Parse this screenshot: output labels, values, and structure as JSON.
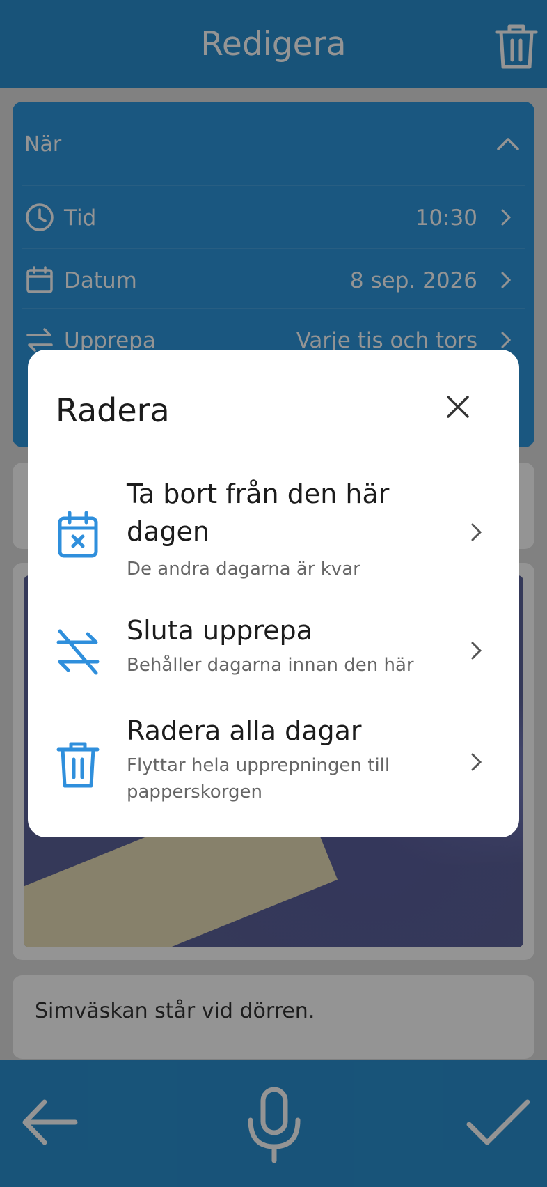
{
  "header": {
    "title": "Redigera",
    "trash_icon": "trash-icon"
  },
  "when": {
    "title": "När",
    "rows": [
      {
        "label": "Tid",
        "value": "10:30",
        "icon": "clock-icon"
      },
      {
        "label": "Datum",
        "value": "8 sep. 2026",
        "icon": "calendar-icon"
      },
      {
        "label": "Upprepa",
        "value": "Varje tis och tors",
        "icon": "repeat-icon"
      }
    ]
  },
  "note": {
    "text": "Simväskan står vid dörren."
  },
  "dialog": {
    "title": "Radera",
    "options": [
      {
        "title": "Ta bort från den här dagen",
        "subtitle": "De andra dagarna är kvar",
        "icon": "calendar-x-icon"
      },
      {
        "title": "Sluta upprepa",
        "subtitle": "Behåller dagarna innan den här",
        "icon": "repeat-off-icon"
      },
      {
        "title": "Radera alla dagar",
        "subtitle": "Flyttar hela upprepningen till papperskorgen",
        "icon": "trash-icon"
      }
    ]
  },
  "colors": {
    "primary": "#2a90d0",
    "accent_icon": "#2f8fdc"
  }
}
